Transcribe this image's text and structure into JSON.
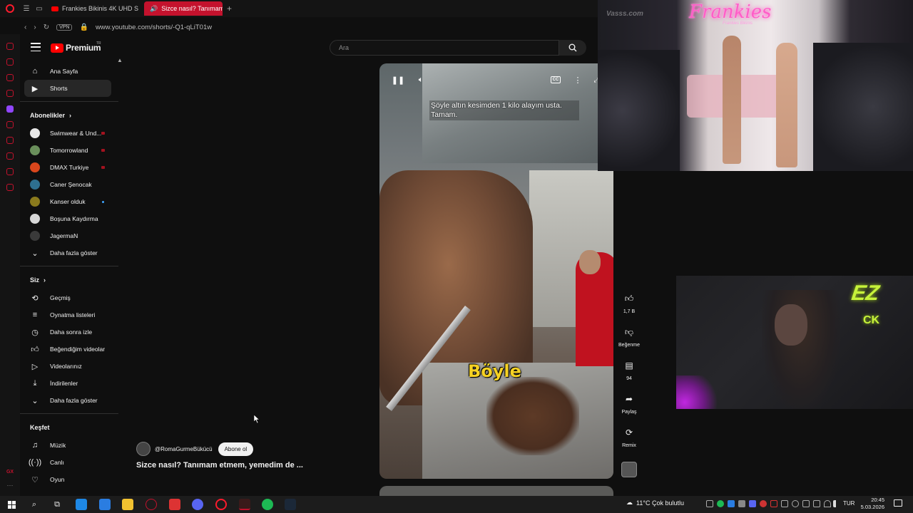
{
  "browser": {
    "tabs": [
      {
        "label": "Frankies Bikinis 4K UHD S"
      },
      {
        "label": "Sizce nasıl? Tanımam e"
      }
    ],
    "url": "www.youtube.com/shorts/-Q1-qLiT01w",
    "vpn_label": "VPN",
    "gx_label": "GX"
  },
  "youtube": {
    "brand": "Premium",
    "country": "TR",
    "search_placeholder": "Ara",
    "nav": {
      "main": [
        {
          "label": "Ana Sayfa",
          "icon": "home-icon"
        },
        {
          "label": "Shorts",
          "icon": "shorts-icon"
        }
      ],
      "subscriptions_title": "Abonelikler",
      "subscriptions": [
        {
          "label": "Swimwear & Und...",
          "color": "#e6e6e6",
          "live": true
        },
        {
          "label": "Tomorrowland",
          "color": "#6a8f5b",
          "live": true
        },
        {
          "label": "DMAX Turkiye",
          "color": "#d9461c",
          "live": true
        },
        {
          "label": "Caner Şenocak",
          "color": "#2e6f8f",
          "live": false
        },
        {
          "label": "Kanser olduk",
          "color": "#8a7a1d",
          "live": false,
          "new": true
        },
        {
          "label": "Boşuna Kaydırma",
          "color": "#d7d7d7",
          "live": false
        },
        {
          "label": "JagermaN",
          "color": "#3a3a3a",
          "live": false
        }
      ],
      "subscriptions_more": "Daha fazla göster",
      "you_title": "Siz",
      "you": [
        {
          "label": "Geçmiş",
          "icon": "history-icon"
        },
        {
          "label": "Oynatma listeleri",
          "icon": "playlists-icon"
        },
        {
          "label": "Daha sonra izle",
          "icon": "watch-later-icon"
        },
        {
          "label": "Beğendiğim videolar",
          "icon": "liked-videos-icon"
        },
        {
          "label": "Videolarınız",
          "icon": "your-videos-icon"
        },
        {
          "label": "İndirilenler",
          "icon": "downloads-icon"
        }
      ],
      "you_more": "Daha fazla göster",
      "explore_title": "Keşfet",
      "explore": [
        {
          "label": "Müzik",
          "icon": "music-icon"
        },
        {
          "label": "Canlı",
          "icon": "live-icon"
        },
        {
          "label": "Oyun",
          "icon": "gaming-icon"
        }
      ]
    },
    "short": {
      "subtitle": "Şöyle altın kesimden 1 kilo alayım usta. Tamam.",
      "caption": "Böyle",
      "channel": "@RomaGurmeBükücü",
      "subscribe_label": "Abone ol",
      "title": "Sizce nasıl? Tanımam etmem, yemedim de ...",
      "cc_label": "CC"
    },
    "actions": {
      "likes": "1,7 B",
      "dislike": "Beğenme",
      "comments": "94",
      "share": "Paylaş",
      "remix": "Remix"
    }
  },
  "overlay": {
    "runway_sign": "Frankies",
    "runway_sign_sub": "Frankies Bikinis",
    "watermark": "Vasss.com",
    "neon_text": "EZ",
    "neon_text2": "CK"
  },
  "taskbar": {
    "weather": "11°C  Çok bulutlu",
    "lang": "TUR",
    "time": "20:45",
    "date": "5.03.2026"
  }
}
